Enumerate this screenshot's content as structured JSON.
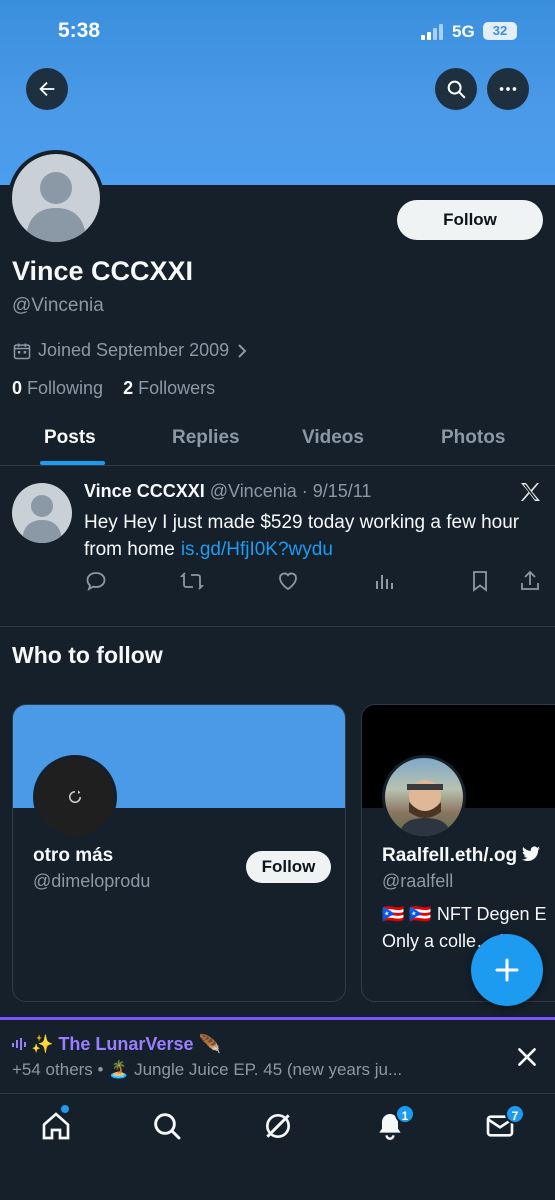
{
  "status_bar": {
    "time": "5:38",
    "network": "5G",
    "battery": "32"
  },
  "profile": {
    "name": "Vince CCCXXI",
    "handle": "@Vincenia",
    "joined": "Joined September 2009",
    "following_count": "0",
    "following_label": "Following",
    "followers_count": "2",
    "followers_label": "Followers",
    "follow_label": "Follow"
  },
  "tabs": [
    "Posts",
    "Replies",
    "Videos",
    "Photos"
  ],
  "post": {
    "name": "Vince CCCXXI",
    "handle_date": "@Vincenia · 9/15/11",
    "text": "Hey Hey I just made $529 today working a few hour from home",
    "link": "is.gd/HfjI0K?wydu"
  },
  "who_to_follow": {
    "title": "Who to follow",
    "cards": [
      {
        "name": "otro más",
        "handle": "@dimeloprodu",
        "follow_label": "Follow",
        "banner_color": "#4a9ae8"
      },
      {
        "name": "Raalfell.eth/.og",
        "handle": "@raalfell",
        "bio_line1": "🇵🇷 🇵🇷 NFT Degen E",
        "bio_line2": "Only a colle… Im",
        "banner_color": "#000000"
      }
    ]
  },
  "space": {
    "title": "✨ The LunarVerse 🪶",
    "subtitle": "+54 others • 🏝️ Jungle Juice EP. 45 (new years ju..."
  },
  "nav": {
    "notifications_badge": "1",
    "messages_badge": "7"
  },
  "colors": {
    "accent": "#1d9bf0",
    "background": "#15202b",
    "space_purple": "#7856ff"
  }
}
